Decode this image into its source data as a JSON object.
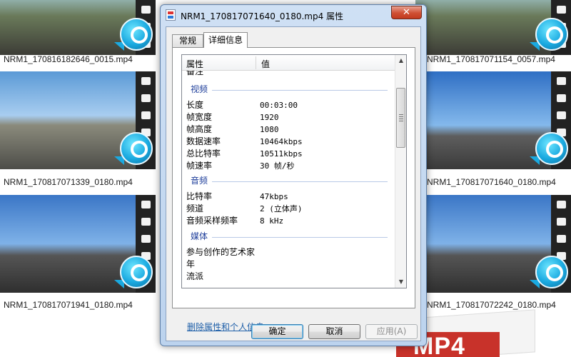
{
  "files": [
    {
      "name": "NRM1_170816182646_0015.mp4"
    },
    {
      "name": "NRM1_170817071154_0057.mp4"
    },
    {
      "name": "NRM1_170817071339_0180.mp4"
    },
    {
      "name": "NRM1_170817071640_0180.mp4"
    },
    {
      "name": "NRM1_170817071941_0180.mp4"
    },
    {
      "name": "NRM1_170817072242_0180.mp4"
    }
  ],
  "badge": {
    "text": "MP4"
  },
  "dialog": {
    "title": "NRM1_170817071640_0180.mp4 属性",
    "close_label": "✕",
    "tabs": [
      "常规",
      "详细信息"
    ],
    "active_tab": "详细信息",
    "columns": {
      "property": "属性",
      "value": "值"
    },
    "top_partial_row": "备注",
    "groups": {
      "video": {
        "label": "视频",
        "rows": [
          {
            "p": "长度",
            "v": "00:03:00"
          },
          {
            "p": "帧宽度",
            "v": "1920"
          },
          {
            "p": "帧高度",
            "v": "1080"
          },
          {
            "p": "数据速率",
            "v": "10464kbps"
          },
          {
            "p": "总比特率",
            "v": "10511kbps"
          },
          {
            "p": "帧速率",
            "v": "30 帧/秒"
          }
        ]
      },
      "audio": {
        "label": "音频",
        "rows": [
          {
            "p": "比特率",
            "v": "47kbps"
          },
          {
            "p": "频道",
            "v": "2 (立体声)"
          },
          {
            "p": "音频采样频率",
            "v": "8 kHz"
          }
        ]
      },
      "media": {
        "label": "媒体",
        "rows": [
          {
            "p": "参与创作的艺术家",
            "v": ""
          },
          {
            "p": "年",
            "v": ""
          },
          {
            "p": "流派",
            "v": ""
          }
        ]
      }
    },
    "remove_link": "删除属性和个人信息",
    "buttons": {
      "ok": "确定",
      "cancel": "取消",
      "apply": "应用(A)"
    }
  },
  "colors": {
    "group_header": "#1f3f9b",
    "link": "#1d5ea8",
    "close": "#c23a1f"
  }
}
